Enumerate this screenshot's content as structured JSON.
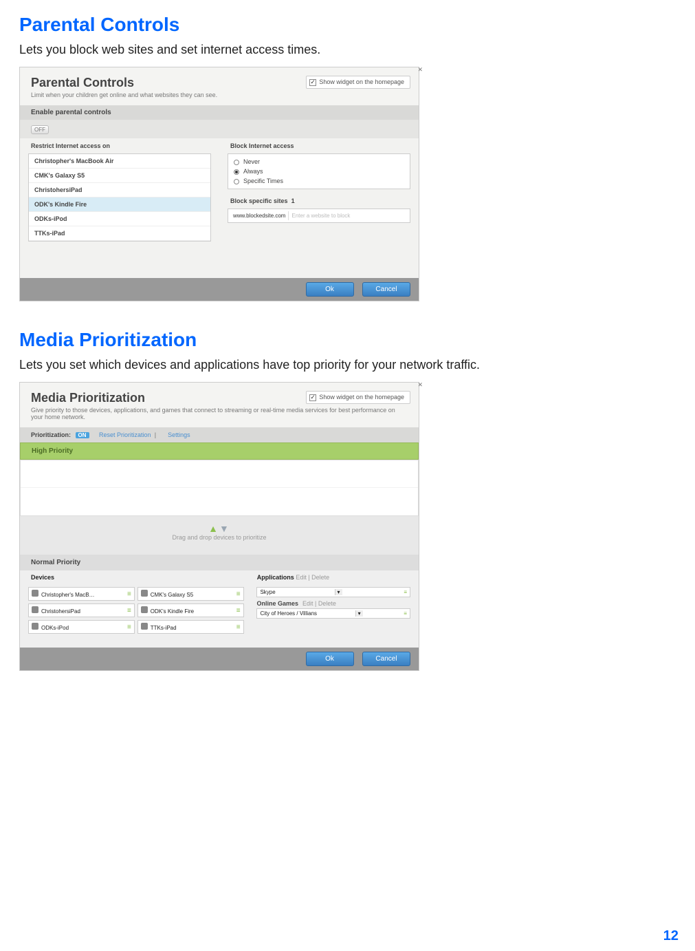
{
  "page_number": "12",
  "sections": [
    {
      "heading": "Parental Controls",
      "desc": "Lets you block web sites and set internet access times."
    },
    {
      "heading": "Media Prioritization",
      "desc": "Lets you set which devices and applications have top priority for your network traffic."
    }
  ],
  "parental": {
    "title": "Parental Controls",
    "sub": "Limit when your children get online and what websites they can see.",
    "widget": "Show widget on the homepage",
    "enable_label": "Enable parental controls",
    "toggle": "OFF",
    "restrict_label": "Restrict Internet access on",
    "block_label": "Block Internet access",
    "devices": [
      "Christopher's MacBook Air",
      "CMK's Galaxy S5",
      "ChristohersiPad",
      "ODK's Kindle Fire",
      "ODKs-iPod",
      "TTKs-iPad"
    ],
    "selected_device_index": 3,
    "block_options": [
      "Never",
      "Always",
      "Specific Times"
    ],
    "block_selected_index": 1,
    "block_sites_label": "Block specific sites",
    "block_sites_count": "1",
    "blocked_site": "www.blockedsite.com",
    "blocked_placeholder": "Enter a website to block",
    "ok": "Ok",
    "cancel": "Cancel"
  },
  "media": {
    "title": "Media Prioritization",
    "sub": "Give priority to those devices, applications, and games that connect to streaming or real-time media services for best performance on your home network.",
    "widget": "Show widget on the homepage",
    "prio_label": "Prioritization:",
    "on": "ON",
    "reset": "Reset Prioritization",
    "settings": "Settings",
    "high_label": "High Priority",
    "drag_text": "Drag and drop devices to prioritize",
    "normal_label": "Normal Priority",
    "devices_label": "Devices",
    "apps_label": "Applications",
    "apps_links": "Edit  |  Delete",
    "games_label": "Online Games",
    "games_links": "Edit  |  Delete",
    "devices": [
      "Christopher's MacB…",
      "CMK's Galaxy S5",
      "ChristohersiPad",
      "ODK's Kindle Fire",
      "ODKs-iPod",
      "TTKs-iPad"
    ],
    "app_selected": "Skype",
    "game_selected": "City of Heroes / Villians",
    "ok": "Ok",
    "cancel": "Cancel"
  }
}
